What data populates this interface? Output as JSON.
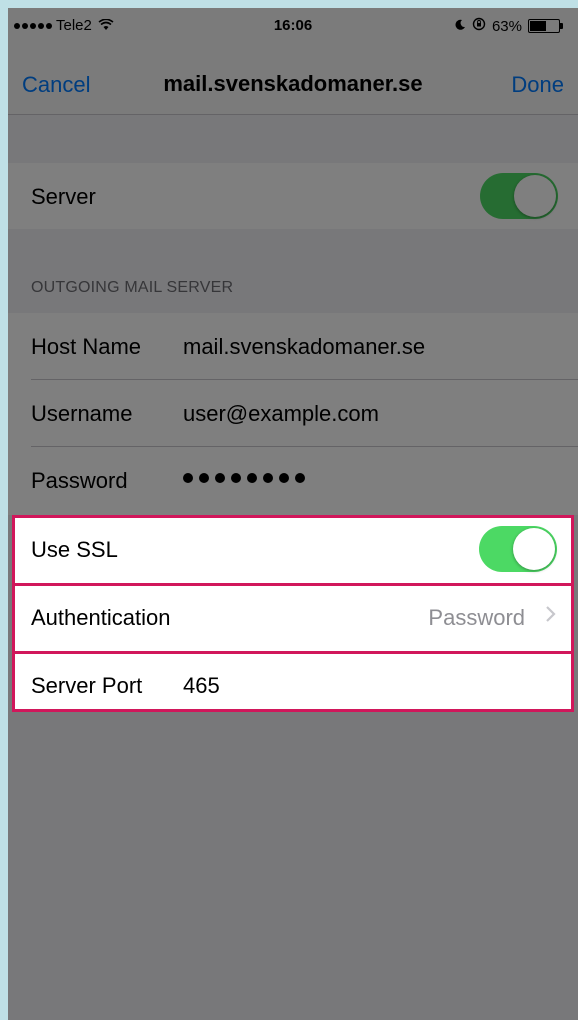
{
  "status_bar": {
    "carrier": "Tele2",
    "time": "16:06",
    "battery": "63%",
    "battery_level": 0.63,
    "icons": [
      "signal-dots-icon",
      "wifi-icon",
      "moon-icon",
      "rotation-lock-icon",
      "battery-icon"
    ]
  },
  "nav": {
    "cancel_label": "Cancel",
    "title": "mail.svenskadomaner.se",
    "done_label": "Done"
  },
  "server_toggle": {
    "label": "Server",
    "on": true
  },
  "outgoing": {
    "section_header": "OUTGOING MAIL SERVER",
    "host_name_label": "Host Name",
    "host_name_value": "mail.svenskadomaner.se",
    "username_label": "Username",
    "username_value": "user@example.com",
    "password_label": "Password",
    "password_masked_length": 8
  },
  "highlighted": {
    "use_ssl_label": "Use SSL",
    "use_ssl_on": true,
    "authentication_label": "Authentication",
    "authentication_value": "Password",
    "server_port_label": "Server Port",
    "server_port_value": "465"
  },
  "colors": {
    "accent": "#007aff",
    "toggle_on": "#4cd964",
    "highlight_border": "#d1175b",
    "page_frame": "#bfe0e6"
  }
}
